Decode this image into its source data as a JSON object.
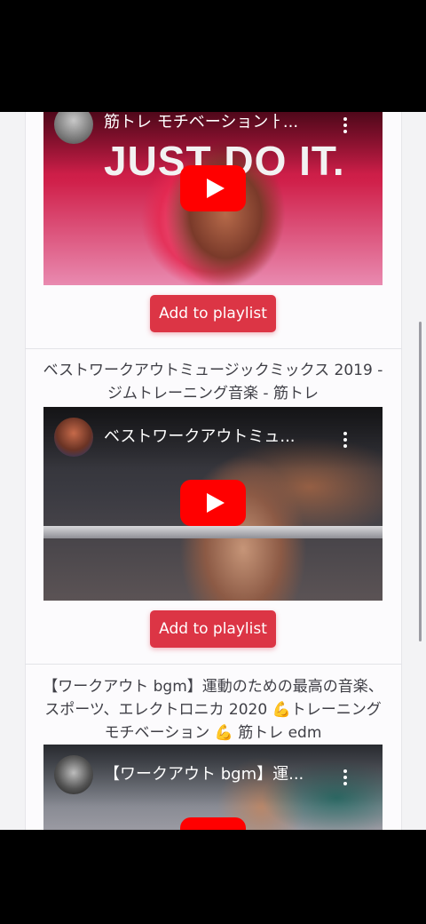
{
  "videos": [
    {
      "title": "",
      "player_label": "筋トレ モチベーションㅏ...",
      "thumb_text": "JUST DO IT.",
      "button_label": "Add to playlist"
    },
    {
      "title": "ベストワークアウトミュージックミックス 2019 - ジムトレーニング音楽 - 筋トレ",
      "player_label": "ベストワークアウトミュ...",
      "button_label": "Add to playlist"
    },
    {
      "title": "【ワークアウト bgm】運動のための最高の音楽、スポーツ、エレクトロニカ 2020 💪トレーニング モチベーション 💪 筋トレ edm",
      "player_label": "【ワークアウト bgm】運...",
      "button_label": ""
    }
  ],
  "colors": {
    "button": "#dc3545",
    "youtube_red": "#ff0000"
  }
}
